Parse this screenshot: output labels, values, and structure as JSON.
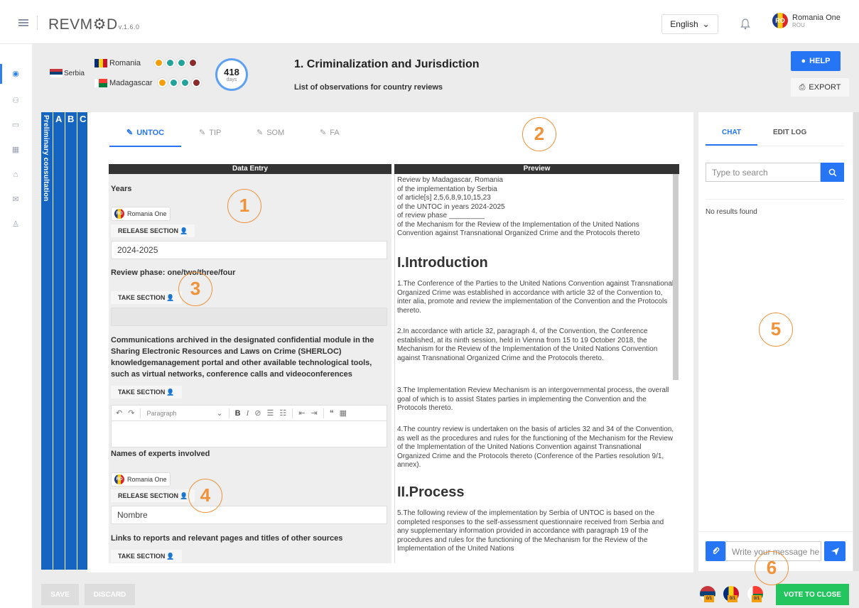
{
  "app": {
    "logo": "REVM⚙D",
    "version": "v.1.6.0"
  },
  "topbar": {
    "language": "English",
    "user_name": "Romania One",
    "user_code": "ROU",
    "user_initials": "RO"
  },
  "review": {
    "reviewed_country": "Serbia",
    "reviewers": [
      {
        "name": "Romania"
      },
      {
        "name": "Madagascar"
      }
    ],
    "days_left": "418",
    "days_label": "days",
    "title": "1. Criminalization and Jurisdiction",
    "subtitle": "List of observations for country reviews"
  },
  "actions": {
    "help": "HELP",
    "export": "EXPORT"
  },
  "strip": {
    "prelim": "Preliminary consultation",
    "a": "A",
    "b": "B",
    "c": "C"
  },
  "tabs": [
    "UNTOC",
    "TIP",
    "SOM",
    "FA"
  ],
  "columns": {
    "entry": "Data Entry",
    "preview": "Preview"
  },
  "form": {
    "years_label": "Years",
    "owner_chip": "Romania One",
    "release_section": "RELEASE SECTION",
    "years_value": "2024-2025",
    "phase_label": "Review phase: one/two/three/four",
    "take_section": "TAKE SECTION",
    "comm_label": "Communications archived in the designated confidential module in the Sharing Electronic Resources and Laws on Crime (SHERLOC) knowledgemanagement portal and other available technological tools, such as virtual networks, conference calls and videoconferences",
    "editor_paragraph": "Paragraph",
    "experts_label": "Names of experts involved",
    "experts_value": "Nombre",
    "links_label": "Links to reports and relevant pages and titles of other sources"
  },
  "preview": {
    "intro_lines": "Review by Madagascar, Romania\nof the implementation by Serbia\nof article[s] 2,5,6,8,9,10,15,23\nof the UNTOC in years 2024-2025\nof review phase _________\nof the Mechanism for the Review of the Implementation of the United Nations Convention against Transnational Organized Crime and the Protocols thereto",
    "h1": "I.Introduction",
    "p1": "1.The Conference of the Parties to the United Nations Convention against Transnational Organized Crime was established in accordance with article 32 of the Convention to, inter alia, promote and review the implementation of the Convention and the Protocols thereto.",
    "p2": "2.In accordance with article 32, paragraph 4, of the Convention, the Conference established, at its ninth session, held in Vienna from 15 to 19 October 2018, the Mechanism for the Review of the Implementation of the United Nations Convention against Transnational Organized Crime and the Protocols thereto.",
    "p3": "3.The Implementation Review Mechanism is an intergovernmental process, the overall goal of which is to assist States parties in implementing the Convention and the Protocols thereto.",
    "p4": "4.The country review is undertaken on the basis of articles 32 and 34 of the Convention, as well as the procedures and rules for the functioning of the Mechanism for the Review of the Implementation of the United Nations Convention against Transnational Organized Crime and the Protocols thereto (Conference of the Parties resolution 9/1, annex).",
    "h2": "II.Process",
    "p5": "5.The following review of the implementation by Serbia of UNTOC is based on the completed responses to the self-assessment questionnaire received from Serbia and any supplementary information provided in accordance with paragraph 19 of the procedures and rules for the functioning of the Mechanism for the Review of the Implementation of the United Nations"
  },
  "chat": {
    "tab_chat": "CHAT",
    "tab_editlog": "EDIT LOG",
    "search_placeholder": "Type to search",
    "no_results": "No results found",
    "message_placeholder": "Write your message he"
  },
  "footer": {
    "save": "SAVE",
    "discard": "DISCARD",
    "vote": "VOTE TO CLOSE",
    "badge": "0/1"
  },
  "annotations": [
    "1",
    "2",
    "3",
    "4",
    "5",
    "6"
  ]
}
